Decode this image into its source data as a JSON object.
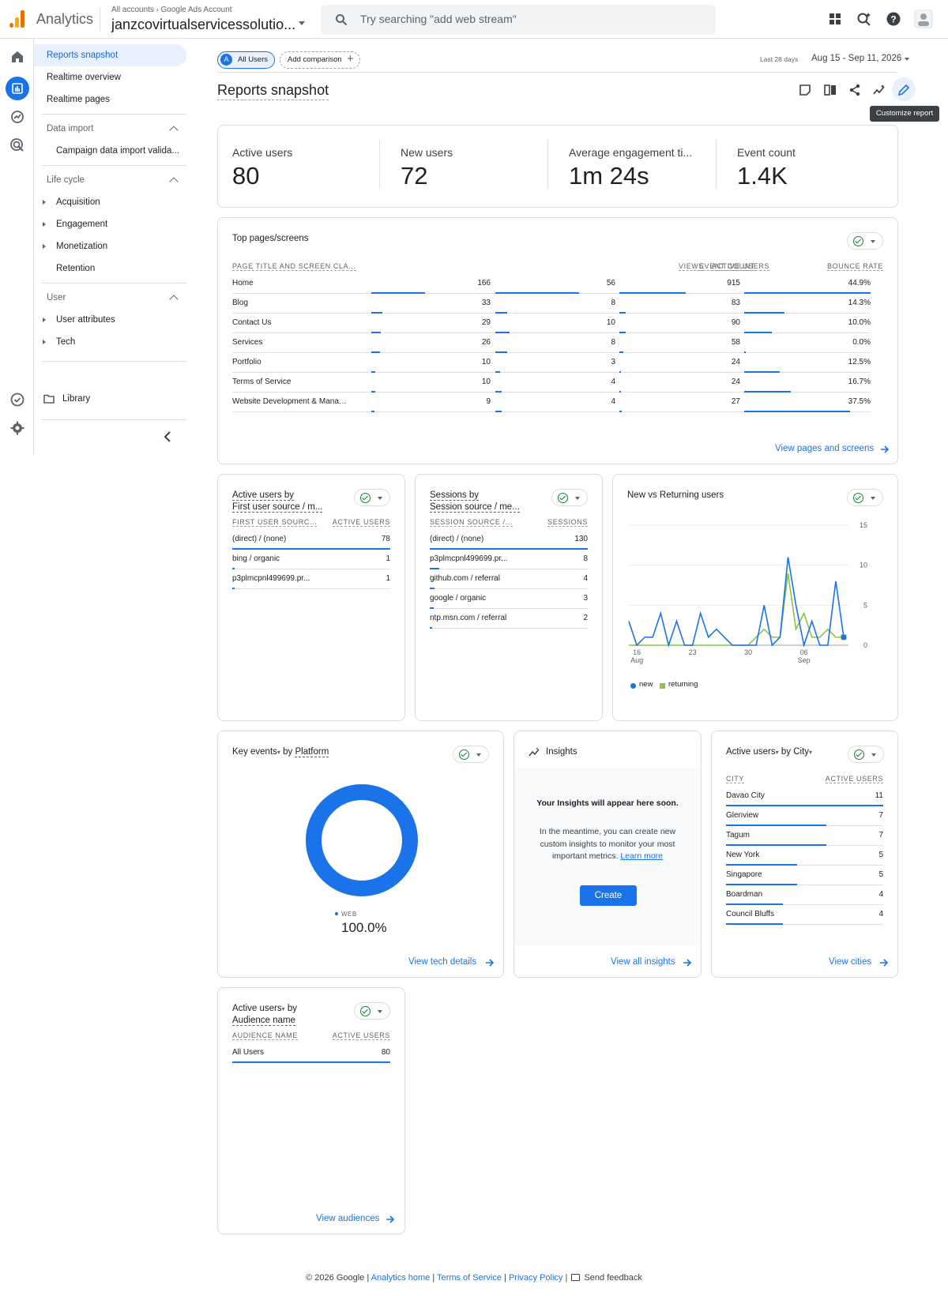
{
  "topbar": {
    "app_name": "Analytics",
    "breadcrumb_all": "All accounts",
    "breadcrumb_sub": "Google Ads Account",
    "account_name": "janzcovirtualservicessolutio...",
    "search_placeholder": "Try searching \"add web stream\""
  },
  "nav": {
    "items": [
      "Reports snapshot",
      "Realtime overview",
      "Realtime pages"
    ],
    "data_import": {
      "header": "Data import",
      "items": [
        "Campaign data import valida..."
      ]
    },
    "lifecycle": {
      "header": "Life cycle",
      "items": [
        "Acquisition",
        "Engagement",
        "Monetization",
        "Retention"
      ]
    },
    "user": {
      "header": "User",
      "items": [
        "User attributes",
        "Tech"
      ]
    },
    "library": "Library"
  },
  "header": {
    "all_users_initial": "A",
    "all_users": "All Users",
    "add_comparison": "Add comparison",
    "date_prefix": "Last 28 days",
    "date_range": "Aug 15 - Sep 11, 2026",
    "title": "Reports snapshot",
    "tooltip": "Customize report"
  },
  "kpis": [
    {
      "label": "Active users",
      "value": "80"
    },
    {
      "label": "New users",
      "value": "72"
    },
    {
      "label": "Average engagement ti...",
      "value": "1m 24s"
    },
    {
      "label": "Event count",
      "value": "1.4K"
    }
  ],
  "top_pages": {
    "title": "Top pages/screens",
    "headers": [
      "PAGE TITLE AND SCREEN CLA...",
      "VIEWS",
      "ACTIVE USERS",
      "EVENT COUNT",
      "BOUNCE RATE"
    ],
    "rows": [
      {
        "page": "Home",
        "views": "166",
        "active": "56",
        "events": "915",
        "bounce": "44.9%",
        "vf": 0.45,
        "af": 0.7,
        "ef": 0.55,
        "bf": 1.0
      },
      {
        "page": "Blog",
        "views": "33",
        "active": "8",
        "events": "83",
        "bounce": "14.3%",
        "vf": 0.09,
        "af": 0.1,
        "ef": 0.05,
        "bf": 0.32
      },
      {
        "page": "Contact Us",
        "views": "29",
        "active": "10",
        "events": "90",
        "bounce": "10.0%",
        "vf": 0.08,
        "af": 0.12,
        "ef": 0.05,
        "bf": 0.22
      },
      {
        "page": "Services",
        "views": "26",
        "active": "8",
        "events": "58",
        "bounce": "0.0%",
        "vf": 0.07,
        "af": 0.1,
        "ef": 0.03,
        "bf": 0.0
      },
      {
        "page": "Portfolio",
        "views": "10",
        "active": "3",
        "events": "24",
        "bounce": "12.5%",
        "vf": 0.03,
        "af": 0.04,
        "ef": 0.015,
        "bf": 0.28
      },
      {
        "page": "Terms of Service",
        "views": "10",
        "active": "4",
        "events": "24",
        "bounce": "16.7%",
        "vf": 0.03,
        "af": 0.05,
        "ef": 0.015,
        "bf": 0.37
      },
      {
        "page": "Website Development & Manage...",
        "views": "9",
        "active": "4",
        "events": "27",
        "bounce": "37.5%",
        "vf": 0.025,
        "af": 0.05,
        "ef": 0.017,
        "bf": 0.84
      }
    ],
    "link": "View pages and screens"
  },
  "first_source": {
    "title_a": "Active users by",
    "title_b": "First user source / m...",
    "headers": [
      "FIRST USER SOURC...",
      "ACTIVE USERS"
    ],
    "rows": [
      {
        "name": "(direct) / (none)",
        "value": "78",
        "f": 1.0
      },
      {
        "name": "bing / organic",
        "value": "1",
        "f": 0.013
      },
      {
        "name": "p3plmcpnl499699.pr...",
        "value": "1",
        "f": 0.013
      }
    ]
  },
  "sessions": {
    "title_a": "Sessions by",
    "title_b": "Session source / me...",
    "headers": [
      "SESSION SOURCE /...",
      "SESSIONS"
    ],
    "rows": [
      {
        "name": "(direct) / (none)",
        "value": "130",
        "f": 1.0
      },
      {
        "name": "p3plmcpnl499699.pr...",
        "value": "8",
        "f": 0.06
      },
      {
        "name": "github.com / referral",
        "value": "4",
        "f": 0.03
      },
      {
        "name": "google / organic",
        "value": "3",
        "f": 0.023
      },
      {
        "name": "ntp.msn.com / referral",
        "value": "2",
        "f": 0.015
      }
    ]
  },
  "new_returning": {
    "title": "New vs Returning users",
    "legend_new": "new",
    "legend_returning": "returning",
    "color_new": "#1a73e8",
    "color_returning": "#8bc34a"
  },
  "chart_data": {
    "type": "line",
    "title": "New vs Returning users",
    "x": [
      "Aug 15",
      "Aug 16",
      "Aug 17",
      "Aug 18",
      "Aug 19",
      "Aug 20",
      "Aug 21",
      "Aug 22",
      "Aug 23",
      "Aug 24",
      "Aug 25",
      "Aug 26",
      "Aug 27",
      "Aug 28",
      "Aug 29",
      "Aug 30",
      "Aug 31",
      "Sep 01",
      "Sep 02",
      "Sep 03",
      "Sep 04",
      "Sep 05",
      "Sep 06",
      "Sep 07",
      "Sep 08",
      "Sep 09",
      "Sep 10",
      "Sep 11"
    ],
    "x_tick_labels": [
      {
        "at": "Aug 16",
        "lines": [
          "16",
          "Aug"
        ]
      },
      {
        "at": "Aug 23",
        "lines": [
          "23"
        ]
      },
      {
        "at": "Aug 30",
        "lines": [
          "30"
        ]
      },
      {
        "at": "Sep 06",
        "lines": [
          "06",
          "Sep"
        ]
      }
    ],
    "y_ticks": [
      "0",
      "5",
      "10",
      "15"
    ],
    "ylim": [
      0,
      15
    ],
    "series": [
      {
        "name": "new",
        "values": [
          3,
          0,
          1,
          1,
          4,
          0,
          3,
          0,
          0,
          4,
          1,
          2,
          1,
          0,
          0,
          0,
          0,
          5,
          0,
          1,
          11,
          5,
          0,
          3,
          0,
          0,
          8,
          1
        ]
      },
      {
        "name": "returning",
        "values": [
          0,
          0,
          0,
          0,
          0,
          0,
          0,
          0,
          0,
          0,
          0,
          0,
          0,
          0,
          0,
          0,
          1,
          2,
          1,
          1,
          9,
          2,
          4,
          1,
          1,
          2,
          1,
          1
        ]
      }
    ]
  },
  "key_events": {
    "title_a": "Key events",
    "title_b": "by",
    "title_c": "Platform",
    "legend": "WEB",
    "value": "100.0%",
    "link": "View tech details",
    "color": "#1a73e8",
    "fraction": 1.0
  },
  "insights": {
    "title": "Insights",
    "heading": "Your Insights will appear here soon.",
    "body": "In the meantime, you can create new custom insights to monitor your most important metrics.",
    "learn_more": "Learn more",
    "create": "Create",
    "link": "View all insights"
  },
  "cities": {
    "title_a": "Active users",
    "title_b": "by",
    "title_c": "City",
    "headers": [
      "CITY",
      "ACTIVE USERS"
    ],
    "rows": [
      {
        "name": "Davao City",
        "value": "11",
        "f": 1.0
      },
      {
        "name": "Glenview",
        "value": "7",
        "f": 0.64
      },
      {
        "name": "Tagum",
        "value": "7",
        "f": 0.64
      },
      {
        "name": "New York",
        "value": "5",
        "f": 0.45
      },
      {
        "name": "Singapore",
        "value": "5",
        "f": 0.45
      },
      {
        "name": "Boardman",
        "value": "4",
        "f": 0.36
      },
      {
        "name": "Council Bluffs",
        "value": "4",
        "f": 0.36
      }
    ],
    "link": "View cities"
  },
  "audience": {
    "title_a": "Active users",
    "title_b": "by",
    "title_c": "Audience name",
    "headers": [
      "AUDIENCE NAME",
      "ACTIVE USERS"
    ],
    "rows": [
      {
        "name": "All Users",
        "value": "80",
        "f": 1.0
      }
    ],
    "link": "View audiences"
  },
  "footer": {
    "copyright": "© 2026 Google |",
    "analytics_home": "Analytics home",
    "sep1": "|",
    "terms": "Terms of Service",
    "sep2": "|",
    "privacy": "Privacy Policy",
    "sep3": "|",
    "feedback": "Send feedback"
  }
}
